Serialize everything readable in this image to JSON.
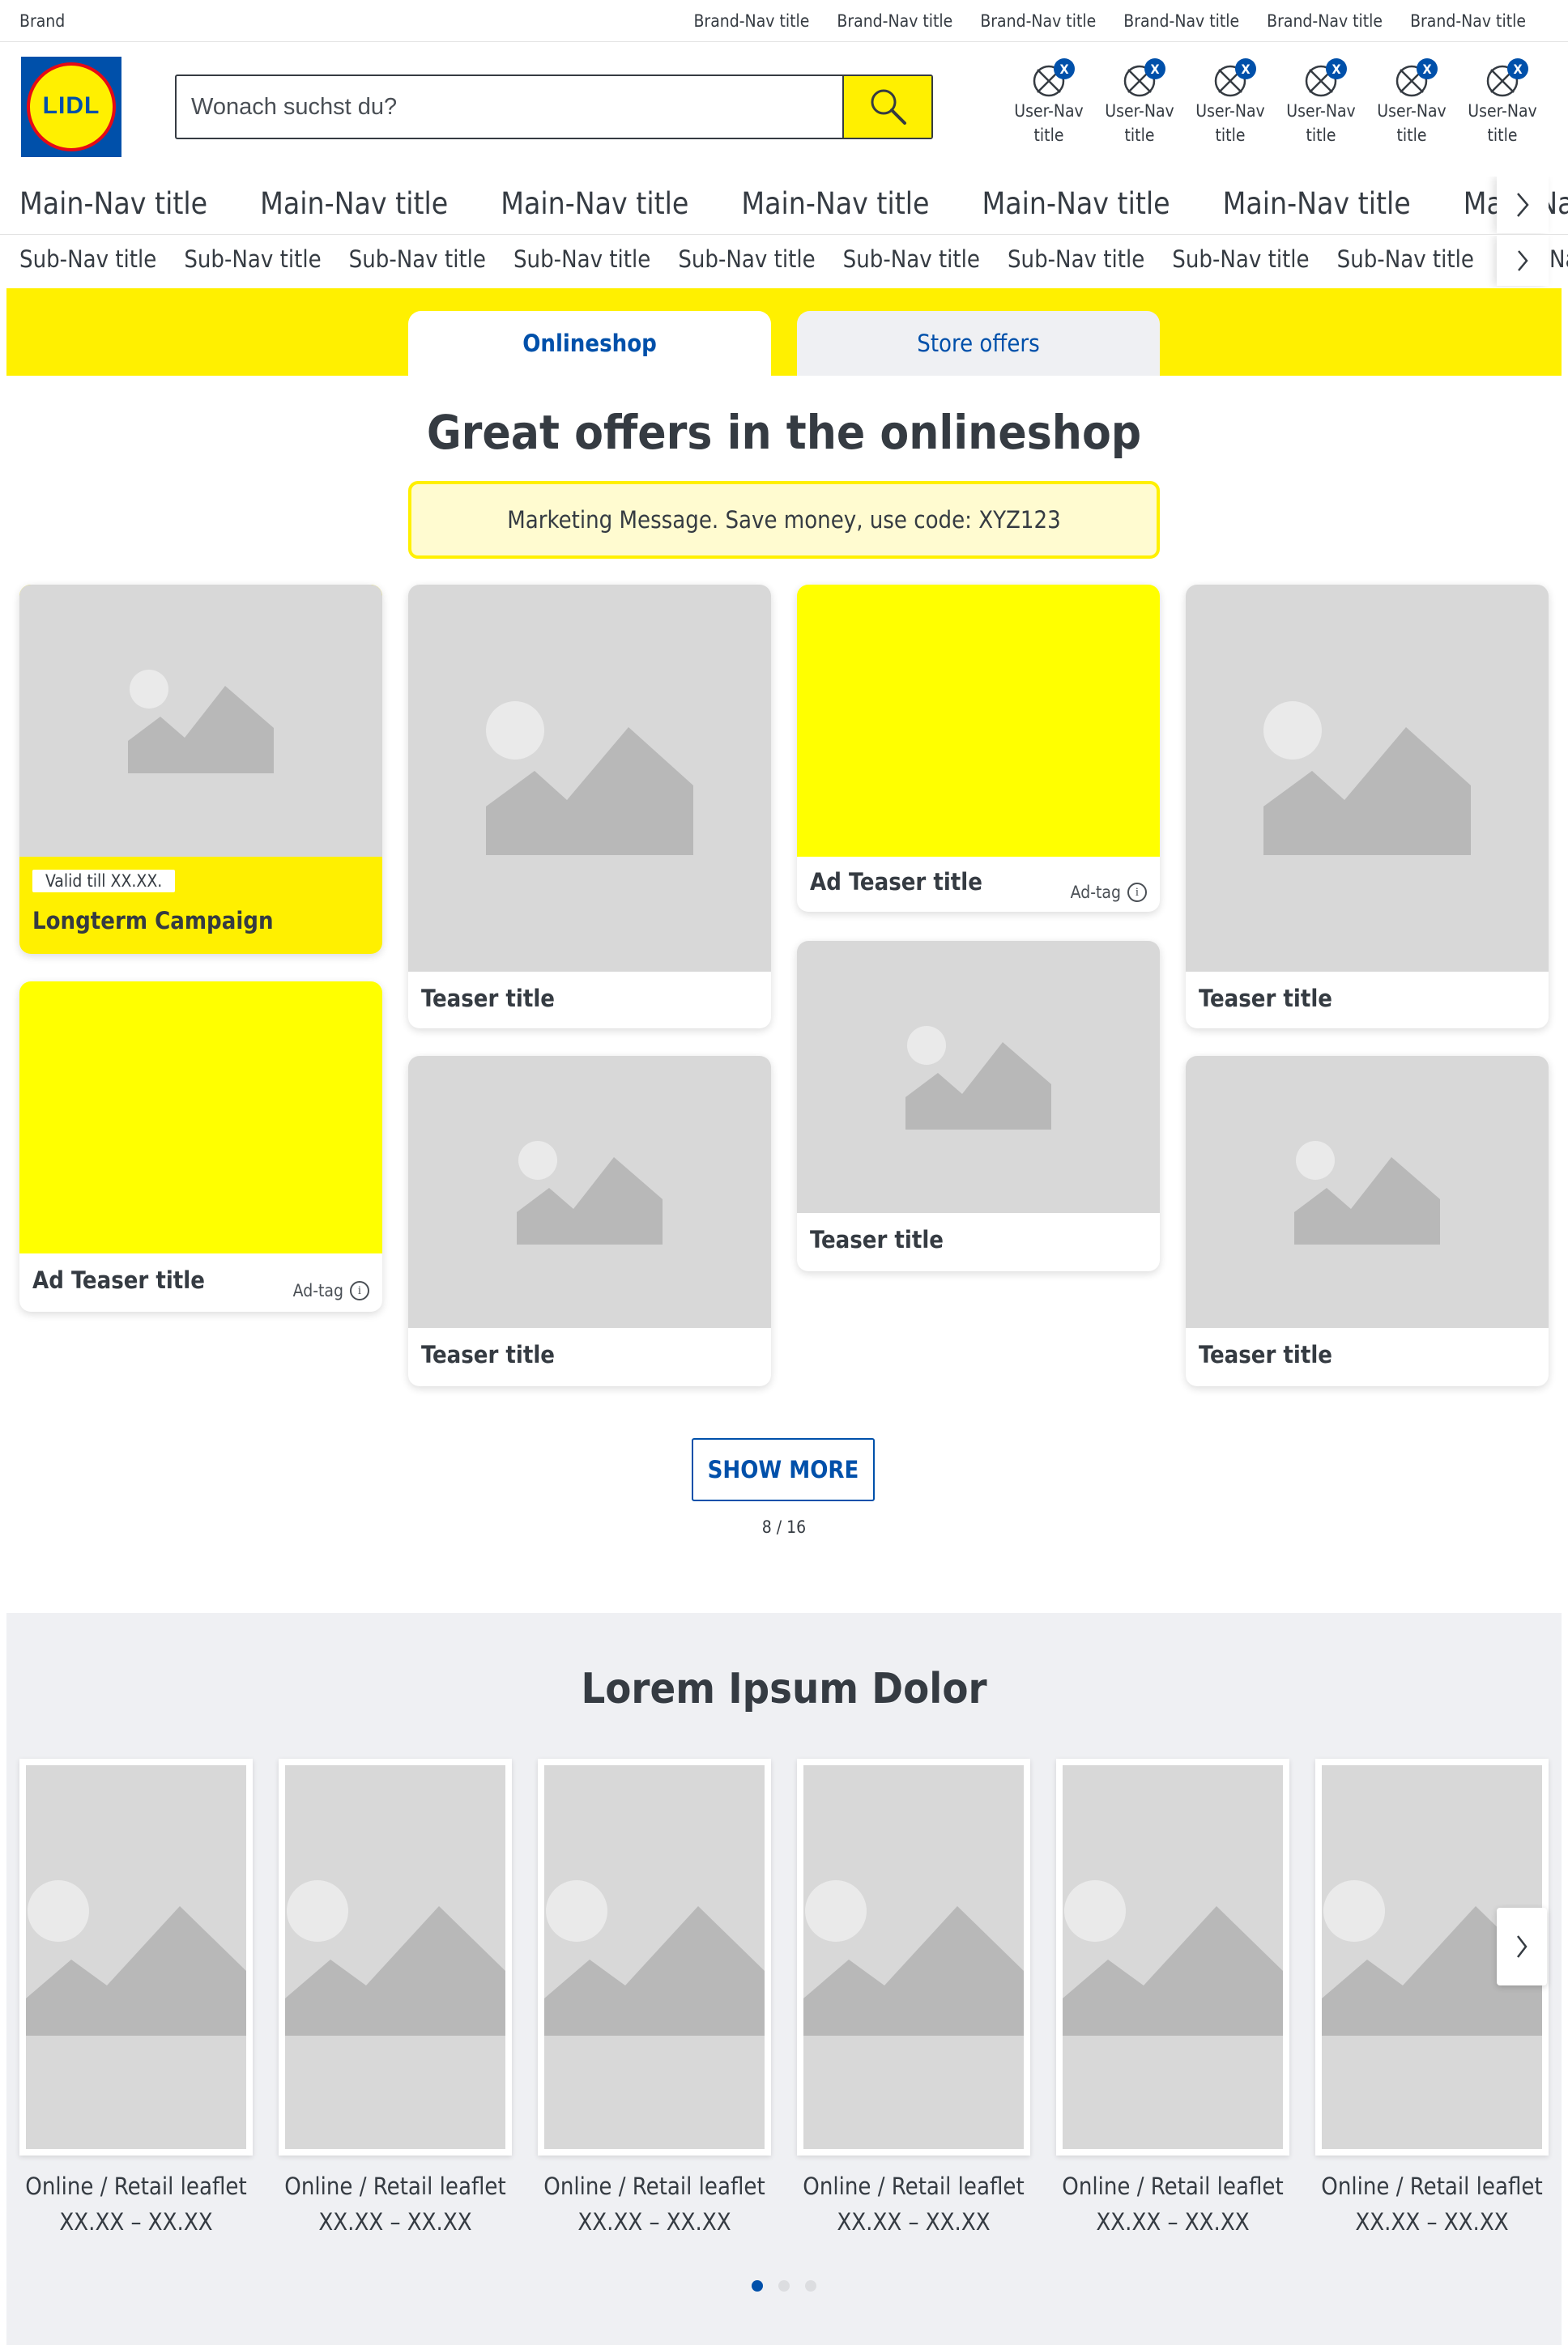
{
  "brand_bar": {
    "brand": "Brand",
    "nav": [
      "Brand-Nav title",
      "Brand-Nav title",
      "Brand-Nav title",
      "Brand-Nav title",
      "Brand-Nav title",
      "Brand-Nav title"
    ]
  },
  "header": {
    "logo_text": "LIDL",
    "search": {
      "placeholder": "Wonach suchst du?",
      "value": ""
    },
    "user_nav": [
      {
        "line1": "User-Nav",
        "line2": "title",
        "badge": "X"
      },
      {
        "line1": "User-Nav",
        "line2": "title",
        "badge": "X"
      },
      {
        "line1": "User-Nav",
        "line2": "title",
        "badge": "X"
      },
      {
        "line1": "User-Nav",
        "line2": "title",
        "badge": "X"
      },
      {
        "line1": "User-Nav",
        "line2": "title",
        "badge": "X"
      },
      {
        "line1": "User-Nav",
        "line2": "title",
        "badge": "X"
      }
    ]
  },
  "main_nav": [
    "Main-Nav title",
    "Main-Nav title",
    "Main-Nav title",
    "Main-Nav title",
    "Main-Nav title",
    "Main-Nav title",
    "Main-Nav title"
  ],
  "sub_nav": [
    "Sub-Nav title",
    "Sub-Nav title",
    "Sub-Nav title",
    "Sub-Nav title",
    "Sub-Nav title",
    "Sub-Nav title",
    "Sub-Nav title",
    "Sub-Nav title",
    "Sub-Nav title",
    "Sub-Nav title"
  ],
  "tabs": [
    {
      "label": "Onlineshop",
      "active": true
    },
    {
      "label": "Store offers",
      "active": false
    }
  ],
  "offers": {
    "title": "Great offers in the onlineshop",
    "marketing": "Marketing Message. Save money, use code: XYZ123",
    "campaign": {
      "badge": "Valid till XX.XX.",
      "title": "Longterm Campaign"
    },
    "ad_teaser": {
      "title": "Ad Teaser title",
      "tag": "Ad-tag",
      "info": "i"
    },
    "teaser_title": "Teaser title",
    "show_more": "SHOW MORE",
    "count": "8 / 16"
  },
  "leaflets": {
    "title": "Lorem Ipsum Dolor",
    "items": [
      {
        "line1": "Online / Retail leaflet",
        "line2": "XX.XX – XX.XX"
      },
      {
        "line1": "Online / Retail leaflet",
        "line2": "XX.XX – XX.XX"
      },
      {
        "line1": "Online / Retail leaflet",
        "line2": "XX.XX – XX.XX"
      },
      {
        "line1": "Online / Retail leaflet",
        "line2": "XX.XX – XX.XX"
      },
      {
        "line1": "Online / Retail leaflet",
        "line2": "XX.XX – XX.XX"
      },
      {
        "line1": "Online / Retail leaflet",
        "line2": "XX.XX – XX.XX"
      }
    ],
    "page_indicator": {
      "pages": 3,
      "active": 1
    }
  },
  "icons": {
    "search": "search-icon",
    "user_nav": "placeholder-icon",
    "arrow": "chevron-right-icon",
    "image": "image-placeholder-icon",
    "info": "info-icon"
  },
  "colors": {
    "brand_yellow": "#fff000",
    "brand_blue": "#0050aa",
    "brand_red": "#e60a14",
    "text": "#353b42",
    "placeholder_gray": "#d8d8d8",
    "section_gray": "#eff0f3",
    "marketing_bg": "#fffbd0"
  }
}
